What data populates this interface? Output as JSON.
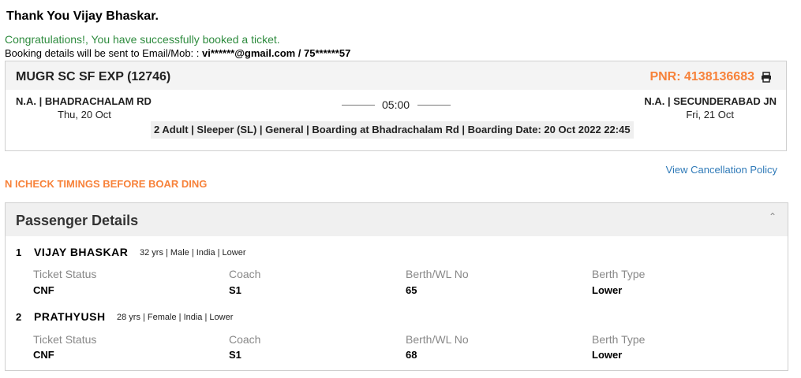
{
  "header": {
    "thanks": "Thank You Vijay Bhaskar.",
    "congrats": "Congratulations!, You have successfully booked a ticket.",
    "booking_label": "Booking details will be sent to Email/Mob: :",
    "booking_contact": "vi******@gmail.com / 75******57"
  },
  "train": {
    "name": "MUGR SC SF EXP (12746)",
    "pnr": "PNR: 4138136683",
    "from_station": "N.A. | BHADRACHALAM RD",
    "from_date": "Thu, 20 Oct",
    "to_station": "N.A. | SECUNDERABAD JN",
    "to_date": "Fri, 21 Oct",
    "duration": "05:00",
    "summary": "2 Adult | Sleeper (SL) | General | Boarding at Bhadrachalam Rd | Boarding Date: 20 Oct 2022 22:45"
  },
  "links": {
    "cancellation": "View Cancellation Policy"
  },
  "alert": "N ICHECK TIMINGS BEFORE BOAR DING",
  "passengers": {
    "title": "Passenger Details",
    "labels": {
      "status": "Ticket Status",
      "coach": "Coach",
      "berth": "Berth/WL No",
      "type": "Berth Type"
    },
    "list": [
      {
        "num": "1",
        "name": "VIJAY BHASKAR",
        "meta": "32 yrs | Male | India | Lower",
        "status": "CNF",
        "coach": "S1",
        "berth": "65",
        "type": "Lower"
      },
      {
        "num": "2",
        "name": "PRATHYUSH",
        "meta": "28 yrs | Female | India | Lower",
        "status": "CNF",
        "coach": "S1",
        "berth": "68",
        "type": "Lower"
      }
    ]
  },
  "icons": {
    "print": "print-icon",
    "collapse": "chevron-up-icon"
  },
  "colors": {
    "accent": "#f7823a",
    "success": "#2e8b3e",
    "link": "#2f7ab8"
  }
}
